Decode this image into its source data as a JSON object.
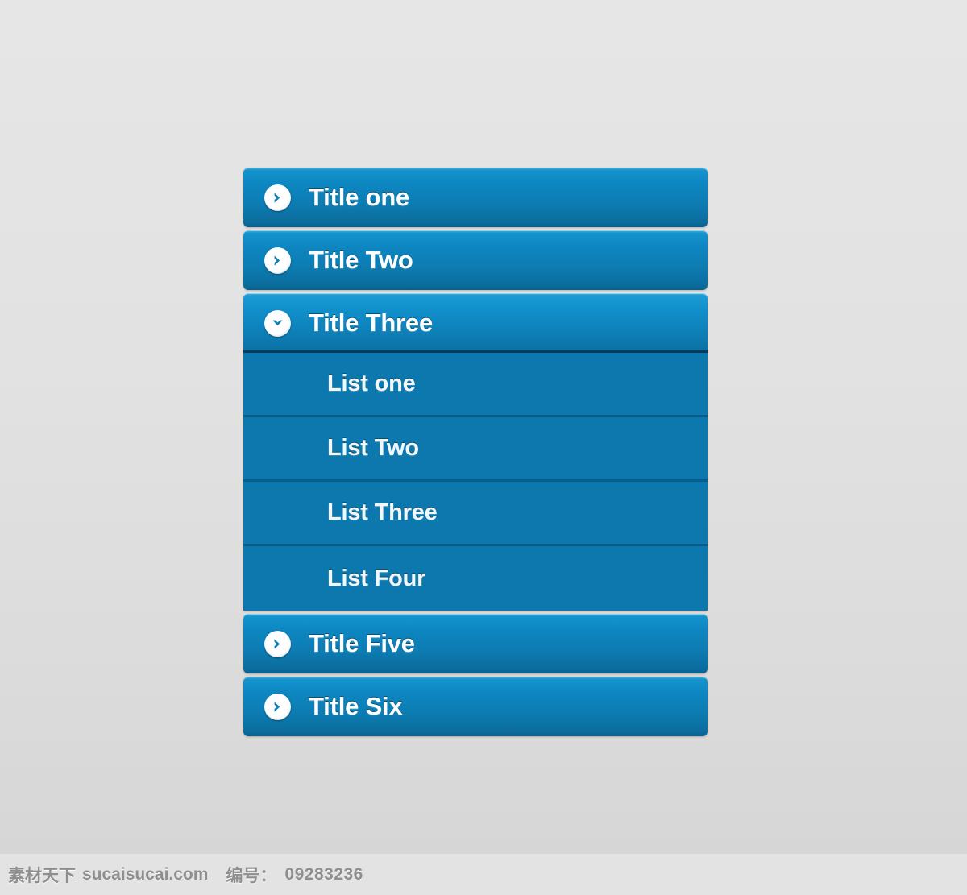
{
  "accordion": {
    "items": [
      {
        "label": "Title one",
        "icon": "chevron-right-circle-icon",
        "state": "collapsed"
      },
      {
        "label": "Title Two",
        "icon": "chevron-right-circle-icon",
        "state": "collapsed"
      },
      {
        "label": "Title Three",
        "icon": "chevron-down-circle-icon",
        "state": "expanded"
      },
      {
        "label": "Title Five",
        "icon": "chevron-right-circle-icon",
        "state": "collapsed"
      },
      {
        "label": "Title Six",
        "icon": "chevron-right-circle-icon",
        "state": "collapsed"
      }
    ],
    "sublist": [
      {
        "label": "List one"
      },
      {
        "label": "List Two"
      },
      {
        "label": "List Three"
      },
      {
        "label": "List Four"
      }
    ]
  },
  "footer": {
    "brand": "素材天下",
    "site": "sucaisucai.com",
    "number_label": "编号：",
    "number_value": "09283236"
  },
  "colors": {
    "bar_top": "#2ea5d8",
    "bar_bottom": "#0a5f8b",
    "sublist_bg": "#0c78ae",
    "sublist_divider": "#0a5d88",
    "page_bg_top": "#e6e6e6",
    "page_bg_bottom": "#d3d3d3",
    "label_text": "#ffffff",
    "footer_text": "#8e8e8e"
  }
}
